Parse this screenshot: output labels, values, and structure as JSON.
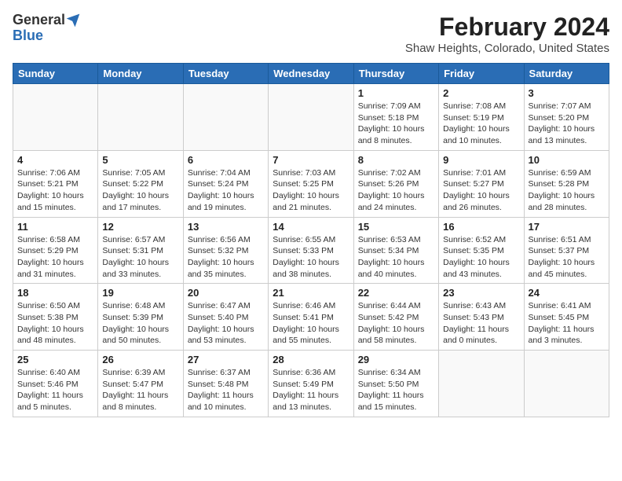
{
  "header": {
    "logo_general": "General",
    "logo_blue": "Blue",
    "title": "February 2024",
    "subtitle": "Shaw Heights, Colorado, United States"
  },
  "weekdays": [
    "Sunday",
    "Monday",
    "Tuesday",
    "Wednesday",
    "Thursday",
    "Friday",
    "Saturday"
  ],
  "weeks": [
    [
      {
        "day": "",
        "detail": ""
      },
      {
        "day": "",
        "detail": ""
      },
      {
        "day": "",
        "detail": ""
      },
      {
        "day": "",
        "detail": ""
      },
      {
        "day": "1",
        "detail": "Sunrise: 7:09 AM\nSunset: 5:18 PM\nDaylight: 10 hours\nand 8 minutes."
      },
      {
        "day": "2",
        "detail": "Sunrise: 7:08 AM\nSunset: 5:19 PM\nDaylight: 10 hours\nand 10 minutes."
      },
      {
        "day": "3",
        "detail": "Sunrise: 7:07 AM\nSunset: 5:20 PM\nDaylight: 10 hours\nand 13 minutes."
      }
    ],
    [
      {
        "day": "4",
        "detail": "Sunrise: 7:06 AM\nSunset: 5:21 PM\nDaylight: 10 hours\nand 15 minutes."
      },
      {
        "day": "5",
        "detail": "Sunrise: 7:05 AM\nSunset: 5:22 PM\nDaylight: 10 hours\nand 17 minutes."
      },
      {
        "day": "6",
        "detail": "Sunrise: 7:04 AM\nSunset: 5:24 PM\nDaylight: 10 hours\nand 19 minutes."
      },
      {
        "day": "7",
        "detail": "Sunrise: 7:03 AM\nSunset: 5:25 PM\nDaylight: 10 hours\nand 21 minutes."
      },
      {
        "day": "8",
        "detail": "Sunrise: 7:02 AM\nSunset: 5:26 PM\nDaylight: 10 hours\nand 24 minutes."
      },
      {
        "day": "9",
        "detail": "Sunrise: 7:01 AM\nSunset: 5:27 PM\nDaylight: 10 hours\nand 26 minutes."
      },
      {
        "day": "10",
        "detail": "Sunrise: 6:59 AM\nSunset: 5:28 PM\nDaylight: 10 hours\nand 28 minutes."
      }
    ],
    [
      {
        "day": "11",
        "detail": "Sunrise: 6:58 AM\nSunset: 5:29 PM\nDaylight: 10 hours\nand 31 minutes."
      },
      {
        "day": "12",
        "detail": "Sunrise: 6:57 AM\nSunset: 5:31 PM\nDaylight: 10 hours\nand 33 minutes."
      },
      {
        "day": "13",
        "detail": "Sunrise: 6:56 AM\nSunset: 5:32 PM\nDaylight: 10 hours\nand 35 minutes."
      },
      {
        "day": "14",
        "detail": "Sunrise: 6:55 AM\nSunset: 5:33 PM\nDaylight: 10 hours\nand 38 minutes."
      },
      {
        "day": "15",
        "detail": "Sunrise: 6:53 AM\nSunset: 5:34 PM\nDaylight: 10 hours\nand 40 minutes."
      },
      {
        "day": "16",
        "detail": "Sunrise: 6:52 AM\nSunset: 5:35 PM\nDaylight: 10 hours\nand 43 minutes."
      },
      {
        "day": "17",
        "detail": "Sunrise: 6:51 AM\nSunset: 5:37 PM\nDaylight: 10 hours\nand 45 minutes."
      }
    ],
    [
      {
        "day": "18",
        "detail": "Sunrise: 6:50 AM\nSunset: 5:38 PM\nDaylight: 10 hours\nand 48 minutes."
      },
      {
        "day": "19",
        "detail": "Sunrise: 6:48 AM\nSunset: 5:39 PM\nDaylight: 10 hours\nand 50 minutes."
      },
      {
        "day": "20",
        "detail": "Sunrise: 6:47 AM\nSunset: 5:40 PM\nDaylight: 10 hours\nand 53 minutes."
      },
      {
        "day": "21",
        "detail": "Sunrise: 6:46 AM\nSunset: 5:41 PM\nDaylight: 10 hours\nand 55 minutes."
      },
      {
        "day": "22",
        "detail": "Sunrise: 6:44 AM\nSunset: 5:42 PM\nDaylight: 10 hours\nand 58 minutes."
      },
      {
        "day": "23",
        "detail": "Sunrise: 6:43 AM\nSunset: 5:43 PM\nDaylight: 11 hours\nand 0 minutes."
      },
      {
        "day": "24",
        "detail": "Sunrise: 6:41 AM\nSunset: 5:45 PM\nDaylight: 11 hours\nand 3 minutes."
      }
    ],
    [
      {
        "day": "25",
        "detail": "Sunrise: 6:40 AM\nSunset: 5:46 PM\nDaylight: 11 hours\nand 5 minutes."
      },
      {
        "day": "26",
        "detail": "Sunrise: 6:39 AM\nSunset: 5:47 PM\nDaylight: 11 hours\nand 8 minutes."
      },
      {
        "day": "27",
        "detail": "Sunrise: 6:37 AM\nSunset: 5:48 PM\nDaylight: 11 hours\nand 10 minutes."
      },
      {
        "day": "28",
        "detail": "Sunrise: 6:36 AM\nSunset: 5:49 PM\nDaylight: 11 hours\nand 13 minutes."
      },
      {
        "day": "29",
        "detail": "Sunrise: 6:34 AM\nSunset: 5:50 PM\nDaylight: 11 hours\nand 15 minutes."
      },
      {
        "day": "",
        "detail": ""
      },
      {
        "day": "",
        "detail": ""
      }
    ]
  ]
}
